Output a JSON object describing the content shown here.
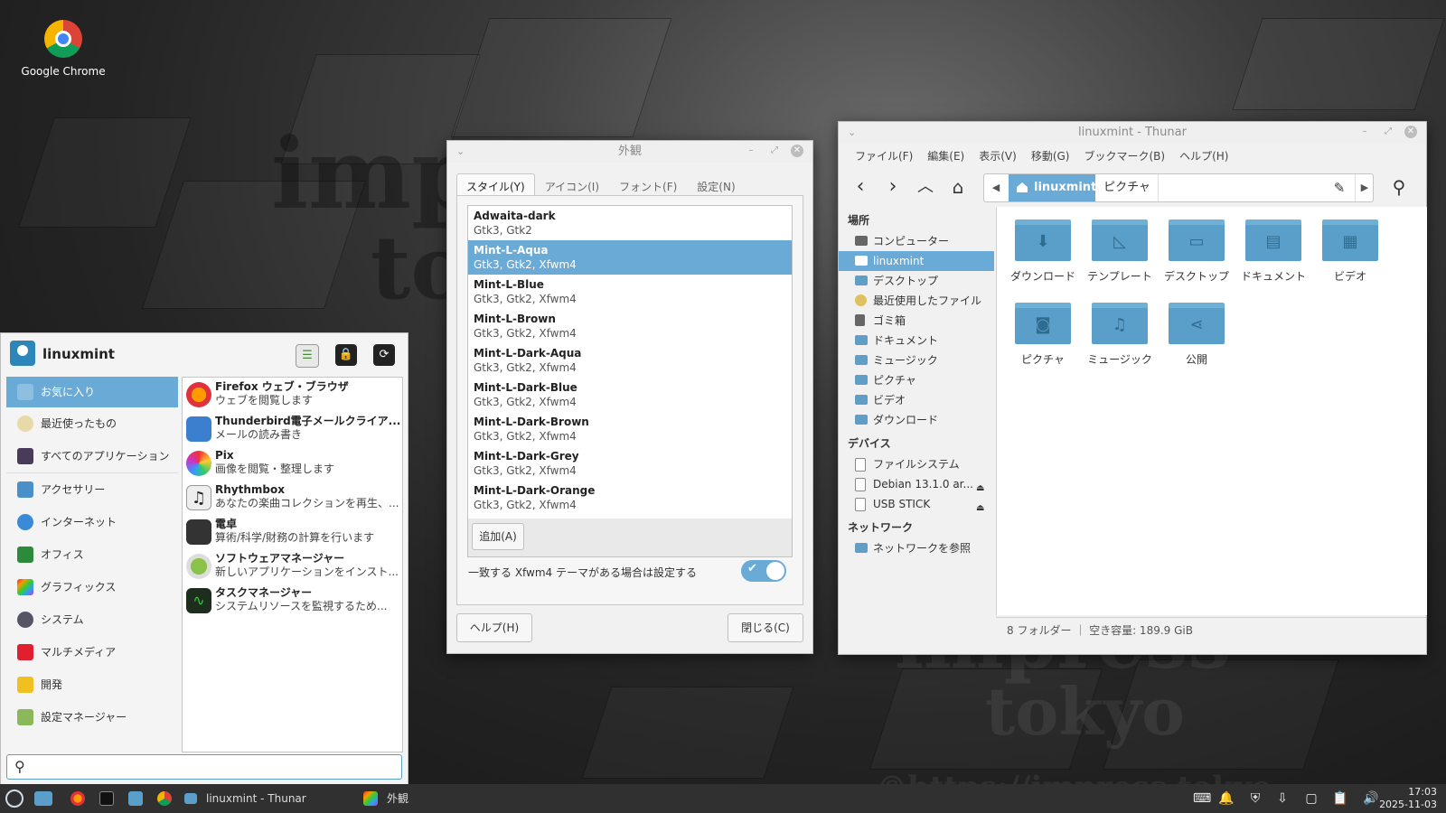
{
  "desktop": {
    "icon_label": "Google Chrome",
    "watermark_1": "impress",
    "watermark_2": "tokyo",
    "watermark_url": "©https://impress.tokyo"
  },
  "appearance": {
    "title": "外観",
    "tabs": [
      "スタイル(Y)",
      "アイコン(I)",
      "フォント(F)",
      "設定(N)"
    ],
    "themes": [
      {
        "name": "Adwaita-dark",
        "sub": "Gtk3, Gtk2"
      },
      {
        "name": "Mint-L-Aqua",
        "sub": "Gtk3, Gtk2, Xfwm4"
      },
      {
        "name": "Mint-L-Blue",
        "sub": "Gtk3, Gtk2, Xfwm4"
      },
      {
        "name": "Mint-L-Brown",
        "sub": "Gtk3, Gtk2, Xfwm4"
      },
      {
        "name": "Mint-L-Dark-Aqua",
        "sub": "Gtk3, Gtk2, Xfwm4"
      },
      {
        "name": "Mint-L-Dark-Blue",
        "sub": "Gtk3, Gtk2, Xfwm4"
      },
      {
        "name": "Mint-L-Dark-Brown",
        "sub": "Gtk3, Gtk2, Xfwm4"
      },
      {
        "name": "Mint-L-Dark-Grey",
        "sub": "Gtk3, Gtk2, Xfwm4"
      },
      {
        "name": "Mint-L-Dark-Orange",
        "sub": "Gtk3, Gtk2, Xfwm4"
      }
    ],
    "selected_theme": "Mint-L-Aqua",
    "add_button": "追加(A)",
    "toggle_label": "一致する Xfwm4 テーマがある場合は設定する",
    "toggle_on": true,
    "help_button": "ヘルプ(H)",
    "close_button": "閉じる(C)"
  },
  "thunar": {
    "title": "linuxmint - Thunar",
    "menu": [
      "ファイル(F)",
      "編集(E)",
      "表示(V)",
      "移動(G)",
      "ブックマーク(B)",
      "ヘルプ(H)"
    ],
    "path": [
      "linuxmint",
      "ピクチャ"
    ],
    "sidebar": {
      "places_header": "場所",
      "places": [
        "コンピューター",
        "linuxmint",
        "デスクトップ",
        "最近使用したファイル",
        "ゴミ箱",
        "ドキュメント",
        "ミュージック",
        "ピクチャ",
        "ビデオ",
        "ダウンロード"
      ],
      "devices_header": "デバイス",
      "devices": [
        "ファイルシステム",
        "Debian 13.1.0 ar...",
        "USB STICK"
      ],
      "network_header": "ネットワーク",
      "network": [
        "ネットワークを参照"
      ]
    },
    "folders": [
      {
        "name": "ダウンロード",
        "icon": "download-arrow"
      },
      {
        "name": "テンプレート",
        "icon": "template"
      },
      {
        "name": "デスクトップ",
        "icon": "desktop"
      },
      {
        "name": "ドキュメント",
        "icon": "document"
      },
      {
        "name": "ビデオ",
        "icon": "film"
      },
      {
        "name": "ピクチャ",
        "icon": "camera"
      },
      {
        "name": "ミュージック",
        "icon": "music-note"
      },
      {
        "name": "公開",
        "icon": "share"
      }
    ],
    "status": "8 フォルダー ｜ 空き容量: 189.9 GiB"
  },
  "whisker": {
    "user": "linuxmint",
    "categories": [
      "お気に入り",
      "最近使ったもの",
      "すべてのアプリケーション",
      "アクセサリー",
      "インターネット",
      "オフィス",
      "グラフィックス",
      "システム",
      "マルチメディア",
      "開発",
      "設定マネージャー"
    ],
    "apps": [
      {
        "name": "Firefox ウェブ・ブラウザ",
        "desc": "ウェブを閲覧します"
      },
      {
        "name": "Thunderbird電子メールクライア...",
        "desc": "メールの読み書き"
      },
      {
        "name": "Pix",
        "desc": "画像を閲覧・整理します"
      },
      {
        "name": "Rhythmbox",
        "desc": "あなたの楽曲コレクションを再生、..."
      },
      {
        "name": "電卓",
        "desc": "算術/科学/財務の計算を行います"
      },
      {
        "name": "ソフトウェアマネージャー",
        "desc": "新しいアプリケーションをインスト..."
      },
      {
        "name": "タスクマネージャー",
        "desc": "システムリソースを監視するため..."
      }
    ]
  },
  "taskbar": {
    "task_thunar": "linuxmint - Thunar",
    "task_appearance": "外観",
    "time": "17:03",
    "date": "2025-11-03"
  },
  "colors": {
    "accent": "#6aaad6",
    "folder": "#5a9fc9",
    "taskbar": "#303030"
  }
}
